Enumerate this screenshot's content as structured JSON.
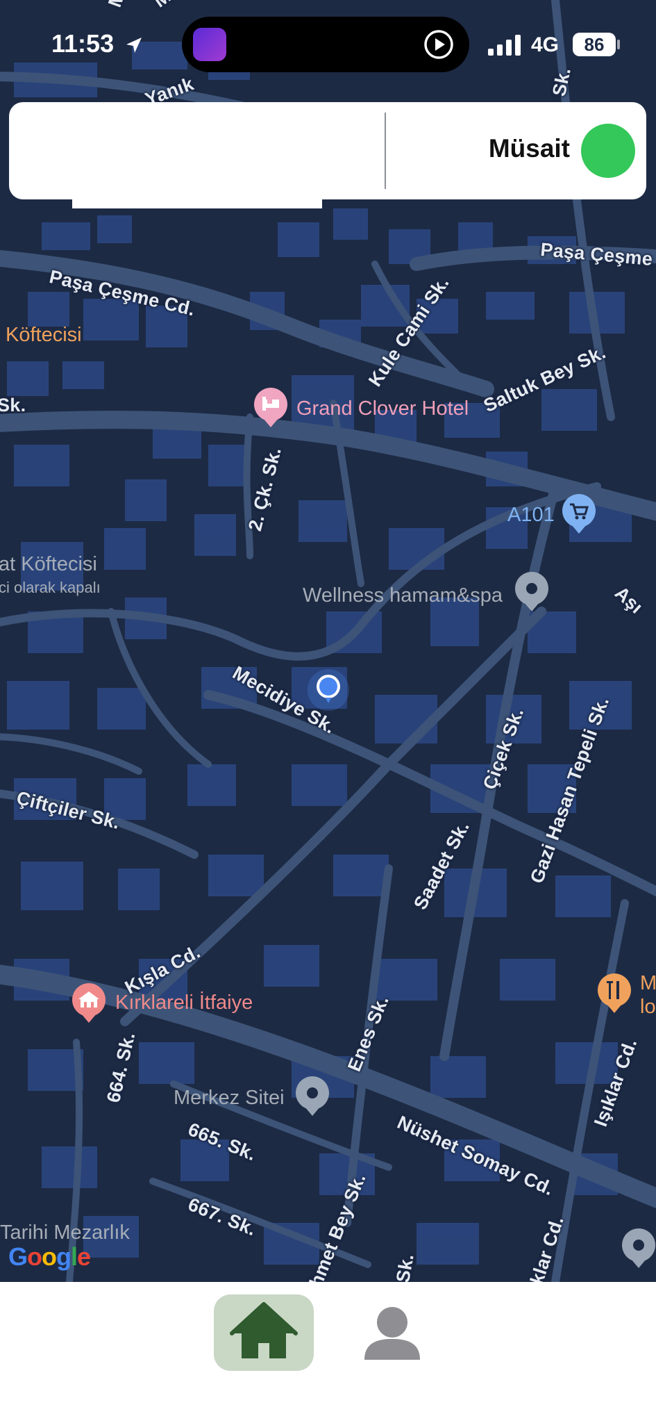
{
  "status_bar": {
    "time": "11:53",
    "network": "4G",
    "battery": "86",
    "icons": [
      "location-arrow-icon",
      "app-thumbnail-icon",
      "play-icon",
      "signal-bars-icon"
    ]
  },
  "top_card": {
    "status_label": "Müsait",
    "status_color": "#34c759"
  },
  "map": {
    "streets": [
      "Yanık",
      "Paşa Çeşme Cd.",
      "Paşa Çeşme",
      "Kule Cami Sk.",
      "Saltuk Bey Sk.",
      "2. Çk. Sk.",
      "Mecidiye Sk.",
      "Çiftçiler Sk.",
      "Çiçek Sk.",
      "Gazi Hasan Tepeli Sk.",
      "Saadet Sk.",
      "Kışla Cd.",
      "664. Sk.",
      "Enes Sk.",
      "665. Sk.",
      "667. Sk.",
      "Nüshet Somay Cd.",
      "Işıklar Cd.",
      "hmet Bey Sk.",
      "Sk.",
      "Sk.",
      "Aşı",
      "Sk.",
      "klar Cd.",
      "M",
      "Mı"
    ],
    "places": [
      "Köftecisi",
      "Grand Clover Hotel",
      "A101",
      "at Köftecisi",
      "ci olarak kapalı",
      "Wellness hamam&spa",
      "Kırklareli İtfaiye",
      "Merkez Sitei",
      "Tarihi Mezarlık",
      "M",
      "lo"
    ],
    "attribution": "Google",
    "colors": {
      "background": "#1d2a44",
      "blocks": "#2b4680",
      "roads": "#3d5478",
      "user_location": "#4a86f0"
    }
  },
  "bottom_nav": {
    "items": [
      {
        "name": "home",
        "icon": "home-icon",
        "active": true
      },
      {
        "name": "profile",
        "icon": "person-icon",
        "active": false
      }
    ],
    "active_bg": "#c9d7c5",
    "active_icon_color": "#2f5b2f",
    "inactive_icon_color": "#8e8e93"
  }
}
